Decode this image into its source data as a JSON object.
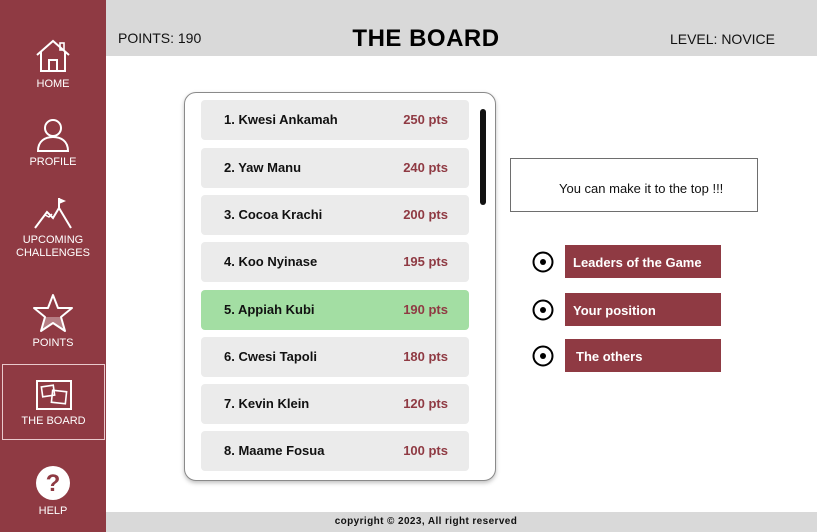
{
  "sidebar": {
    "items": [
      {
        "label": "HOME",
        "icon": "home-icon"
      },
      {
        "label": "PROFILE",
        "icon": "user-icon"
      },
      {
        "label": "UPCOMING\nCHALLENGES",
        "icon": "mountain-flag-icon"
      },
      {
        "label": "POINTS",
        "icon": "star-icon"
      },
      {
        "label": "THE BOARD",
        "icon": "board-icon",
        "active": true
      },
      {
        "label": "HELP",
        "icon": "question-icon"
      }
    ]
  },
  "header": {
    "points": "POINTS: 190",
    "title": "THE BOARD",
    "level": "LEVEL: NOVICE"
  },
  "leaderboard": [
    {
      "name": "1. Kwesi Ankamah",
      "points": "250 pts"
    },
    {
      "name": "2. Yaw Manu",
      "points": "240 pts"
    },
    {
      "name": "3. Cocoa Krachi",
      "points": "200 pts"
    },
    {
      "name": "4. Koo Nyinase",
      "points": "195 pts"
    },
    {
      "name": "5. Appiah Kubi",
      "points": "190 pts",
      "highlight": true
    },
    {
      "name": "6. Cwesi Tapoli",
      "points": "180 pts"
    },
    {
      "name": "7. Kevin Klein",
      "points": "120 pts"
    },
    {
      "name": "8. Maame Fosua",
      "points": "100 pts"
    }
  ],
  "message": "You can make it to the top !!!",
  "options": [
    {
      "label": "Leaders of the Game"
    },
    {
      "label": "Your position"
    },
    {
      "label": "The others"
    }
  ],
  "footer": {
    "copyright": "copyright © 2023, All right reserved"
  },
  "colors": {
    "brand": "#8f3a43",
    "highlight_row": "#a3dea3",
    "bar_grey": "#d9d9d9",
    "row_grey": "#ebebeb"
  }
}
